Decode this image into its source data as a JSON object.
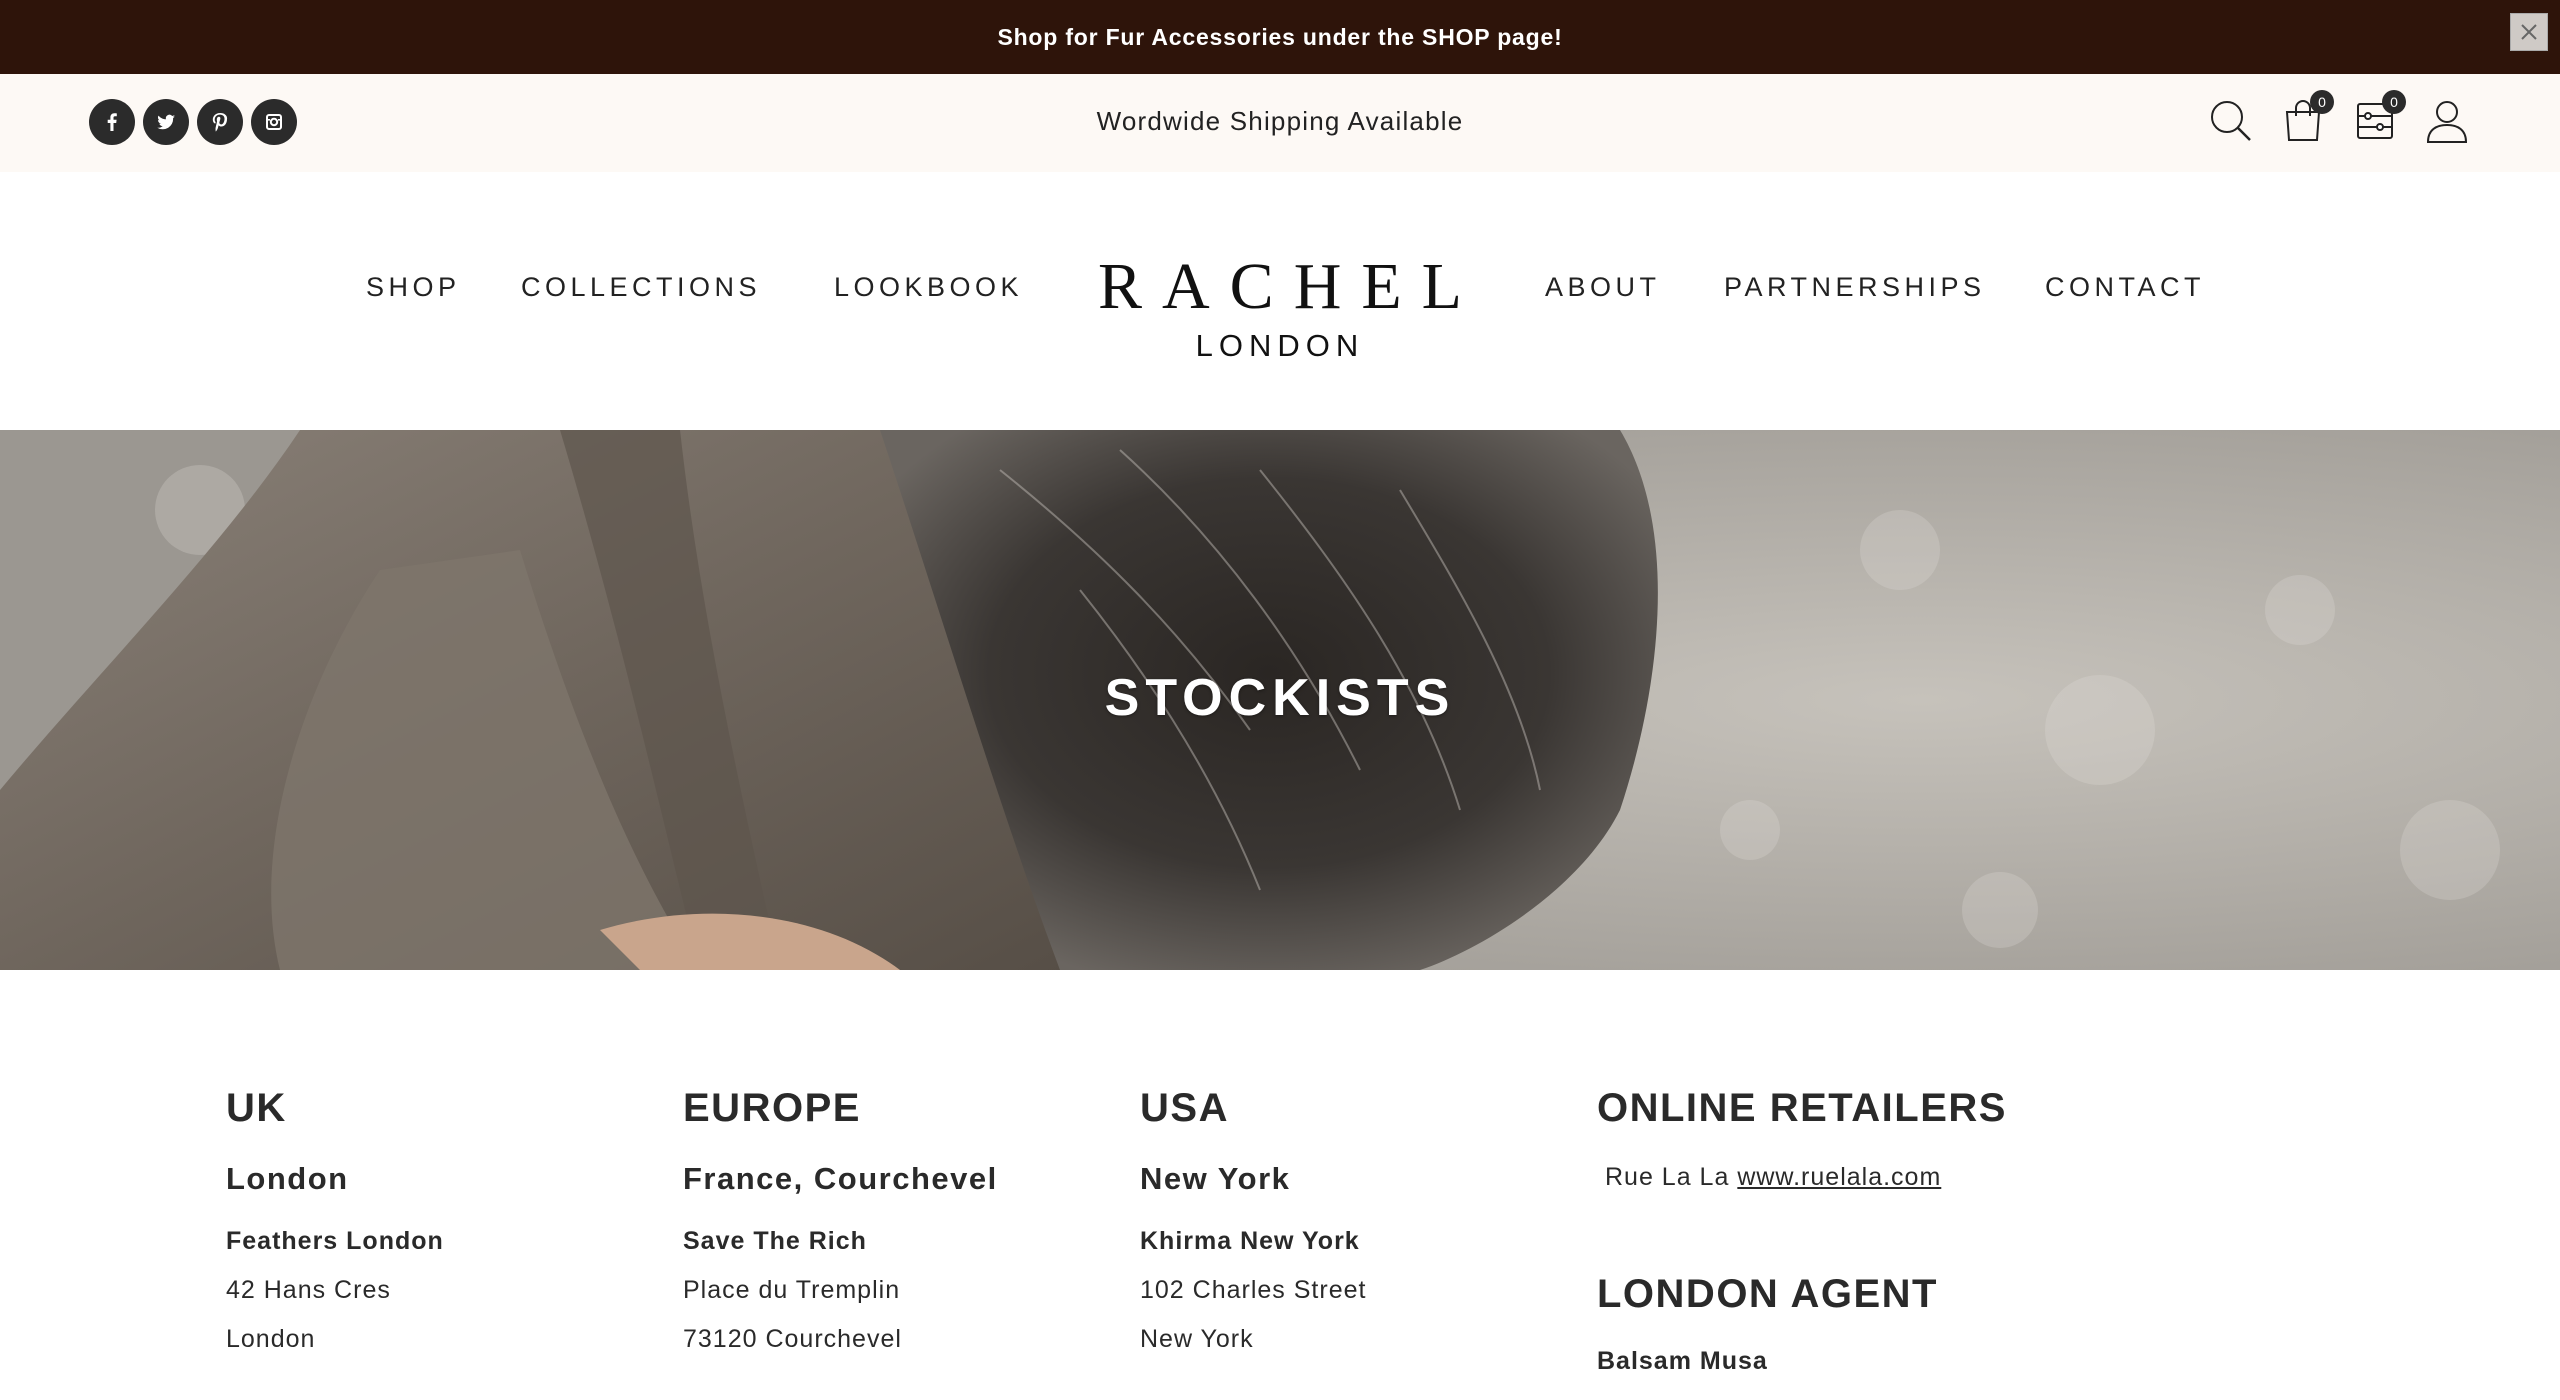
{
  "announcement": {
    "text": "Shop for Fur Accessories under the SHOP page!",
    "close_icon": "close-icon"
  },
  "utility": {
    "shipping_text": "Wordwide Shipping Available",
    "socials": [
      "facebook-icon",
      "twitter-icon",
      "pinterest-icon",
      "instagram-icon"
    ],
    "cart_count": "0",
    "compare_count": "0"
  },
  "nav": {
    "left": [
      "SHOP",
      "COLLECTIONS",
      "LOOKBOOK"
    ],
    "right": [
      "ABOUT",
      "PARTNERSHIPS",
      "CONTACT"
    ],
    "logo_main": "RACHEL",
    "logo_sub": "LONDON"
  },
  "hero": {
    "title": "STOCKISTS"
  },
  "stockists": {
    "uk": {
      "region": "UK",
      "city": "London",
      "store": "Feathers London",
      "lines": [
        "42 Hans Cres",
        "London"
      ]
    },
    "europe": {
      "region": "EUROPE",
      "city": "France, Courchevel",
      "store": "Save The Rich",
      "lines": [
        "Place du Tremplin",
        "73120 Courchevel"
      ]
    },
    "usa": {
      "region": "USA",
      "city": "New York",
      "store": "Khirma New York",
      "lines": [
        "102 Charles Street",
        "New York"
      ]
    },
    "online": {
      "region": "ONLINE RETAILERS",
      "retailer_name": "Rue La La",
      "retailer_link": "www.ruelala.com",
      "agent_heading": "LONDON AGENT",
      "agent_name": "Balsam Musa"
    }
  },
  "colors": {
    "announcement_bg": "#2e140a",
    "utility_bg": "#fdf9f5",
    "text": "#2a2a2a"
  }
}
